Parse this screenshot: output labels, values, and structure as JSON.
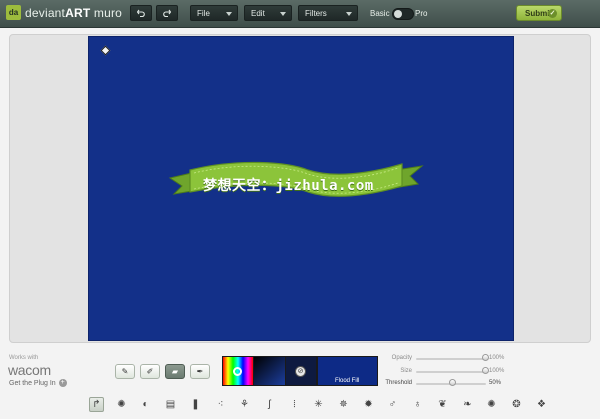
{
  "app": {
    "brand_light": "deviant",
    "brand_bold": "ART",
    "brand_suffix": " muro",
    "logo_mark": "da"
  },
  "toolbar": {
    "undo_icon": "undo-icon",
    "redo_icon": "redo-icon",
    "file_label": "File",
    "edit_label": "Edit",
    "filters_label": "Filters",
    "basic_label": "Basic",
    "pro_label": "Pro",
    "submit_label": "Submit",
    "submit_check": "✓"
  },
  "canvas": {
    "background_color": "#133089",
    "banner_text": "梦想天空：jizhula.com",
    "banner_color": "#8cc43a"
  },
  "sponsor": {
    "works_with": "Works with",
    "wacom": "wacom",
    "plugin_text": "Get the Plug In",
    "plugin_plus": "+"
  },
  "brush_modes": [
    {
      "icon": "brush-icon",
      "glyph": "✎",
      "active": false
    },
    {
      "icon": "pencil-icon",
      "glyph": "✐",
      "active": false
    },
    {
      "icon": "eraser-icon",
      "glyph": "▰",
      "active": true
    },
    {
      "icon": "smudge-icon",
      "glyph": "✒",
      "active": false
    }
  ],
  "color": {
    "eyedropper_glyph": "⊘",
    "fill_label": "Flood Fill",
    "current_color": "#0d2a86"
  },
  "sliders": [
    {
      "label": "Opacity",
      "value": "100%",
      "fraction": 1.0,
      "emphasis": false
    },
    {
      "label": "Size",
      "value": "100%",
      "fraction": 1.0,
      "emphasis": false
    },
    {
      "label": "Threshold",
      "value": "50%",
      "fraction": 0.5,
      "emphasis": true
    }
  ],
  "tools": [
    {
      "name": "selection-tool-icon",
      "glyph": "↱",
      "selected": true
    },
    {
      "name": "soft-brush-icon",
      "glyph": "✺",
      "selected": false
    },
    {
      "name": "circle-brush-icon",
      "glyph": "◐",
      "selected": false
    },
    {
      "name": "hatch-brush-icon",
      "glyph": "▤",
      "selected": false
    },
    {
      "name": "ink-brush-icon",
      "glyph": "❚",
      "selected": false
    },
    {
      "name": "dots-brush-icon",
      "glyph": "⁖",
      "selected": false
    },
    {
      "name": "spray-brush-icon",
      "glyph": "⚘",
      "selected": false
    },
    {
      "name": "curl-brush-icon",
      "glyph": "ʃ",
      "selected": false
    },
    {
      "name": "lines-brush-icon",
      "glyph": "⦙",
      "selected": false
    },
    {
      "name": "sketch-brush-icon",
      "glyph": "✳",
      "selected": false
    },
    {
      "name": "web-brush-icon",
      "glyph": "✵",
      "selected": false
    },
    {
      "name": "fur-brush-icon",
      "glyph": "✹",
      "selected": false
    },
    {
      "name": "ribbon-brush-icon",
      "glyph": "♂",
      "selected": false
    },
    {
      "name": "chain-brush-icon",
      "glyph": "♁",
      "selected": false
    },
    {
      "name": "feather-brush-icon",
      "glyph": "❦",
      "selected": false
    },
    {
      "name": "leaf-brush-icon",
      "glyph": "❧",
      "selected": false
    },
    {
      "name": "drop-brush-icon",
      "glyph": "✺",
      "selected": false
    },
    {
      "name": "pattern-brush-icon",
      "glyph": "❂",
      "selected": false
    },
    {
      "name": "cube-brush-icon",
      "glyph": "❖",
      "selected": false
    }
  ]
}
